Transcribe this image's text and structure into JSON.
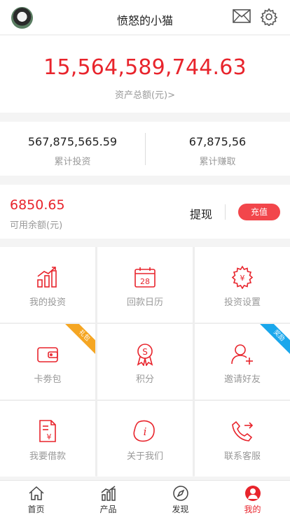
{
  "header": {
    "username": "愤怒的小猫"
  },
  "assets": {
    "total": "15,564,589,744.63",
    "total_label": "资产总额(元)>"
  },
  "stats": [
    {
      "value": "567,875,565.59",
      "label": "累计投资"
    },
    {
      "value": "67,875,56",
      "label": "累计赚取"
    }
  ],
  "balance": {
    "amount": "6850.65",
    "label": "可用余额(元)",
    "withdraw": "提现",
    "recharge": "充值"
  },
  "menu": [
    {
      "label": "我的投资",
      "icon": "bar-chart-icon"
    },
    {
      "label": "回款日历",
      "icon": "calendar-icon",
      "calendar_day": "28"
    },
    {
      "label": "投资设置",
      "icon": "gear-yen-icon"
    },
    {
      "label": "卡劵包",
      "icon": "wallet-icon",
      "ribbon": "礼包"
    },
    {
      "label": "积分",
      "icon": "medal-icon",
      "medal_letter": "S"
    },
    {
      "label": "邀请好友",
      "icon": "add-user-icon",
      "ribbon": "奖励"
    },
    {
      "label": "我要借款",
      "icon": "document-yen-icon"
    },
    {
      "label": "关于我们",
      "icon": "info-icon"
    },
    {
      "label": "联系客服",
      "icon": "phone-icon"
    }
  ],
  "tabs": [
    {
      "label": "首页",
      "icon": "home-icon"
    },
    {
      "label": "产品",
      "icon": "chart-icon"
    },
    {
      "label": "发现",
      "icon": "compass-icon"
    },
    {
      "label": "我的",
      "icon": "user-icon",
      "active": true
    }
  ],
  "colors": {
    "accent": "#e8242c",
    "ribbon_gift": "#f5a623",
    "ribbon_reward": "#1aa7ec"
  }
}
